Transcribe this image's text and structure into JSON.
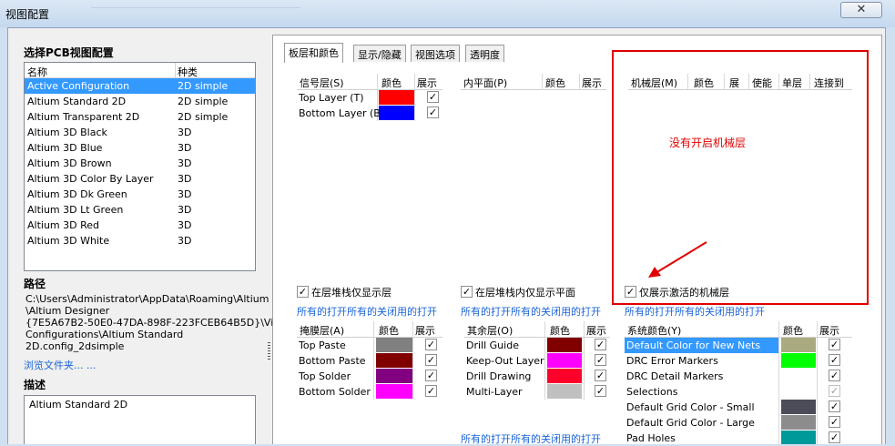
{
  "window": {
    "title": "视图配置",
    "close_glyph": "✕"
  },
  "left": {
    "select_label": "选择PCB视图配置",
    "columns": {
      "name": "名称",
      "type": "种类"
    },
    "configs": [
      {
        "name": "Active Configuration",
        "type": "2D simple"
      },
      {
        "name": "Altium Standard 2D",
        "type": "2D simple"
      },
      {
        "name": "Altium Transparent 2D",
        "type": "2D simple"
      },
      {
        "name": "Altium 3D Black",
        "type": "3D"
      },
      {
        "name": "Altium 3D Blue",
        "type": "3D"
      },
      {
        "name": "Altium 3D Brown",
        "type": "3D"
      },
      {
        "name": "Altium 3D Color By Layer",
        "type": "3D"
      },
      {
        "name": "Altium 3D Dk Green",
        "type": "3D"
      },
      {
        "name": "Altium 3D Lt Green",
        "type": "3D"
      },
      {
        "name": "Altium 3D Red",
        "type": "3D"
      },
      {
        "name": "Altium 3D White",
        "type": "3D"
      }
    ],
    "path_label": "路径",
    "path_lines": [
      "C:\\Users\\Administrator\\AppData\\Roaming\\Altium",
      "\\Altium Designer",
      "{7E5A67B2-50E0-47DA-898F-223FCEB64B5D}\\View",
      "Configurations\\Altium Standard",
      "2D.config_2dsimple"
    ],
    "browse_link": "浏览文件夹... ...",
    "desc_label": "描述",
    "desc_value": "Altium Standard 2D"
  },
  "tabs": [
    "板层和颜色",
    "显示/隐藏",
    "视图选项",
    "透明度"
  ],
  "signal": {
    "headers": [
      "信号层(S)",
      "颜色",
      "展示"
    ],
    "rows": [
      {
        "name": "Top Layer (T)",
        "color": "#ff0000",
        "shown": true
      },
      {
        "name": "Bottom Layer (B)",
        "color": "#0000ff",
        "shown": true
      }
    ],
    "only_stack_label": "在层堆栈仅显示层",
    "links": "所有的打开所有的关闭用的打开"
  },
  "plane": {
    "headers": [
      "内平面(P)",
      "颜色",
      "展示"
    ],
    "only_stack_label": "在层堆栈内仅显示平面",
    "links": "所有的打开所有的关闭用的打开"
  },
  "mech": {
    "headers": [
      "机械层(M)",
      "颜色",
      "展",
      "使能",
      "单层",
      "连接到"
    ],
    "note": "没有开启机械层",
    "only_active_label": "仅展示激活的机械层",
    "links": "所有的打开所有的关闭用的打开"
  },
  "mask": {
    "headers": [
      "掩膜层(A)",
      "颜色",
      "展示"
    ],
    "rows": [
      {
        "name": "Top Paste",
        "color": "#808080",
        "shown": true
      },
      {
        "name": "Bottom Paste",
        "color": "#800000",
        "shown": true
      },
      {
        "name": "Top Solder",
        "color": "#800080",
        "shown": true
      },
      {
        "name": "Bottom Solder",
        "color": "#ff00ff",
        "shown": true
      }
    ]
  },
  "other": {
    "headers": [
      "其余层(O)",
      "颜色",
      "展示"
    ],
    "rows": [
      {
        "name": "Drill Guide",
        "color": "#800000",
        "shown": true
      },
      {
        "name": "Keep-Out Layer",
        "color": "#ff00ff",
        "shown": true
      },
      {
        "name": "Drill Drawing",
        "color": "#ff002a",
        "shown": true
      },
      {
        "name": "Multi-Layer",
        "color": "#c0c0c0",
        "shown": true
      }
    ],
    "links": "所有的打开所有的关闭用的打开"
  },
  "system": {
    "headers": [
      "系统颜色(Y)",
      "颜色",
      "展示"
    ],
    "rows": [
      {
        "name": "Default Color for New Nets",
        "color": "#aaaa80",
        "shown": true
      },
      {
        "name": "DRC Error Markers",
        "color": "#00ff00",
        "shown": true
      },
      {
        "name": "DRC Detail Markers",
        "color": "#ffffff",
        "shown": true
      },
      {
        "name": "Selections",
        "color": "#ffffff",
        "shown": true
      },
      {
        "name": "Default Grid Color - Small",
        "color": "#4c4c58",
        "shown": true
      },
      {
        "name": "Default Grid Color - Large",
        "color": "#8c8c8c",
        "shown": true
      },
      {
        "name": "Pad Holes",
        "color": "#009999",
        "shown": true
      }
    ]
  },
  "colors": {
    "selection": "#3399ff",
    "link": "#1a64d6",
    "annotation": "#e00000"
  }
}
